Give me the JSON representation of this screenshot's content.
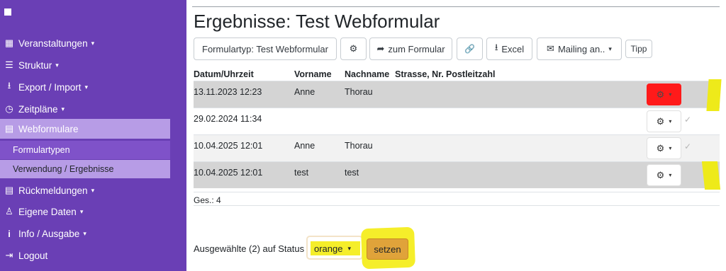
{
  "sidebar": {
    "items": [
      {
        "label": "Veranstaltungen",
        "icon": "calendar-icon",
        "glyph": "▦",
        "caret": "▾"
      },
      {
        "label": "Struktur",
        "icon": "sliders-icon",
        "glyph": "☰",
        "caret": "▾"
      },
      {
        "label": "Export / Import",
        "icon": "download-icon",
        "glyph": "⭳",
        "caret": "▾"
      },
      {
        "label": "Zeitpläne",
        "icon": "clock-icon",
        "glyph": "◷",
        "caret": "▾"
      },
      {
        "label": "Webformulare",
        "icon": "form-icon",
        "glyph": "▤",
        "caret": ""
      },
      {
        "label": "Rückmeldungen",
        "icon": "list-icon",
        "glyph": "▤",
        "caret": "▾"
      },
      {
        "label": "Eigene Daten",
        "icon": "user-icon",
        "glyph": "♙",
        "caret": "▾"
      },
      {
        "label": "Info / Ausgabe",
        "icon": "info-icon",
        "glyph": "i",
        "caret": "▾"
      },
      {
        "label": "Logout",
        "icon": "logout-icon",
        "glyph": "⇥",
        "caret": ""
      }
    ],
    "subitems": [
      {
        "label": "Formulartypen"
      },
      {
        "label": "Verwendung / Ergebnisse"
      }
    ]
  },
  "page": {
    "title": "Ergebnisse: Test Webformular"
  },
  "toolbar": {
    "formtype_label": "Formulartyp: Test Webformular",
    "settings_icon": "gears-icon",
    "settings_glyph": "⚙",
    "to_form_label": "zum Formular",
    "to_form_glyph": "➦",
    "link_glyph": "🔗",
    "excel_label": "Excel",
    "excel_glyph": "⭳",
    "mailing_label": "Mailing an..",
    "mailing_glyph": "✉",
    "caret_glyph": "▾",
    "tip_label": "Tipp"
  },
  "table": {
    "headers": [
      "Datum/Uhrzeit",
      "Vorname",
      "Nachname",
      "Strasse, Nr.",
      "Postleitzahl"
    ],
    "rows": [
      {
        "datetime": "13.11.2023 12:23",
        "firstname": "Anne",
        "lastname": "Thorau",
        "status_color": "#ff1a1a"
      },
      {
        "datetime": "29.02.2024 11:34",
        "firstname": "",
        "lastname": "",
        "status_color": "#ffffff"
      },
      {
        "datetime": "10.04.2025 12:01",
        "firstname": "Anne",
        "lastname": "Thorau",
        "status_color": "#ffffff"
      },
      {
        "datetime": "10.04.2025 12:01",
        "firstname": "test",
        "lastname": "test",
        "status_color": "#ffffff"
      }
    ],
    "gear_glyph": "⚙",
    "caret_glyph": "▾",
    "check_glyph": "✓",
    "total": "Ges.: 4"
  },
  "bulk": {
    "label": "Ausgewählte (2) auf Status",
    "status_value": "orange",
    "set_label": "setzen"
  },
  "colors": {
    "sidebar": "#6a3fb5",
    "active": "#b79ce6",
    "highlight": "#f5ee2a",
    "red": "#ff1a1a",
    "orange": "#e0a33a"
  }
}
